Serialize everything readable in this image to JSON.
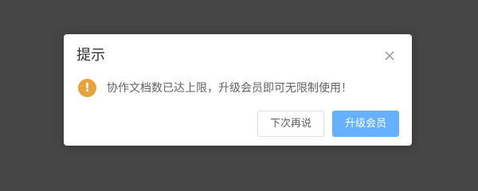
{
  "dialog": {
    "title": "提示",
    "message": "协作文档数已达上限，升级会员即可无限制使用！",
    "icon": "warning-icon",
    "warning_glyph": "!",
    "buttons": {
      "later_label": "下次再说",
      "upgrade_label": "升级会员"
    }
  },
  "colors": {
    "overlay": "#464646",
    "warning": "#e6a23c",
    "primary": "#66b1ff"
  }
}
